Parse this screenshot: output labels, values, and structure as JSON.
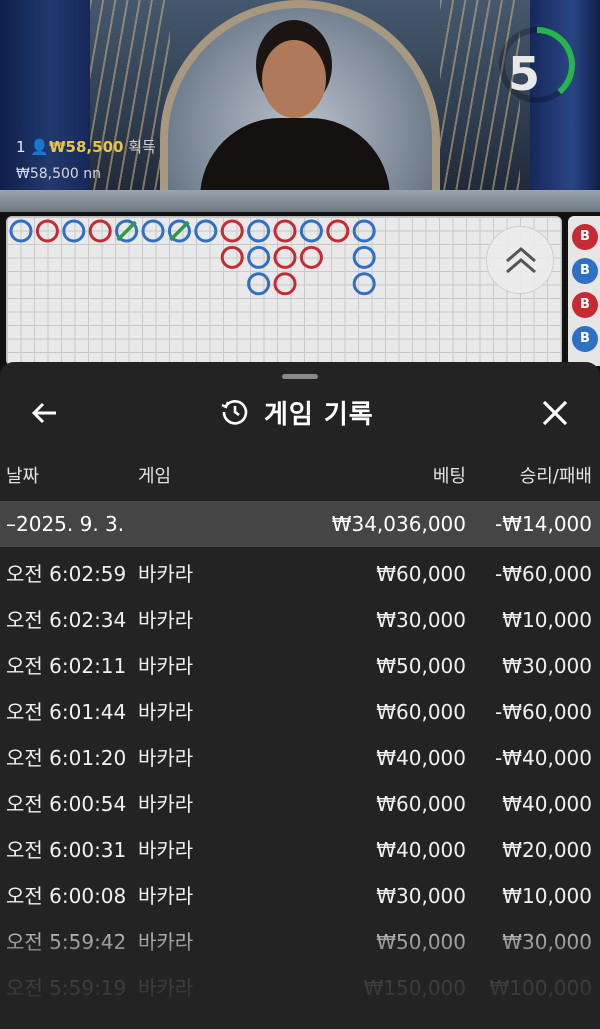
{
  "stream": {
    "countdown": "5",
    "players_count": "1",
    "players_amount": "₩58,500",
    "players_suffix": "획득",
    "players_sub": "₩58,500 nn"
  },
  "bead_road": {
    "columns": [
      [
        "P"
      ],
      [
        "B"
      ],
      [
        "P"
      ],
      [
        "B"
      ],
      [
        "P-tie"
      ],
      [
        "P"
      ],
      [
        "P-tie"
      ],
      [
        "P"
      ],
      [
        "B",
        "B"
      ],
      [
        "P",
        "P",
        "P"
      ],
      [
        "B",
        "B",
        "B"
      ],
      [
        "P",
        "B"
      ],
      [
        "B"
      ],
      [
        "P",
        "P",
        "P"
      ]
    ],
    "side_labels": [
      "B",
      "B",
      "B",
      "B"
    ]
  },
  "history": {
    "title": "게임 기록",
    "headers": {
      "date": "날짜",
      "game": "게임",
      "bet": "베팅",
      "result": "승리/패배"
    },
    "summary": {
      "date": "–2025. 9. 3.",
      "bet": "₩34,036,000",
      "result": "-₩14,000"
    },
    "rows": [
      {
        "time": "오전 6:02:59",
        "game": "바카라",
        "bet": "₩60,000",
        "result": "-₩60,000"
      },
      {
        "time": "오전 6:02:34",
        "game": "바카라",
        "bet": "₩30,000",
        "result": "₩10,000"
      },
      {
        "time": "오전 6:02:11",
        "game": "바카라",
        "bet": "₩50,000",
        "result": "₩30,000"
      },
      {
        "time": "오전 6:01:44",
        "game": "바카라",
        "bet": "₩60,000",
        "result": "-₩60,000"
      },
      {
        "time": "오전 6:01:20",
        "game": "바카라",
        "bet": "₩40,000",
        "result": "-₩40,000"
      },
      {
        "time": "오전 6:00:54",
        "game": "바카라",
        "bet": "₩60,000",
        "result": "₩40,000"
      },
      {
        "time": "오전 6:00:31",
        "game": "바카라",
        "bet": "₩40,000",
        "result": "₩20,000"
      },
      {
        "time": "오전 6:00:08",
        "game": "바카라",
        "bet": "₩30,000",
        "result": "₩10,000"
      },
      {
        "time": "오전 5:59:42",
        "game": "바카라",
        "bet": "₩50,000",
        "result": "₩30,000"
      },
      {
        "time": "오전 5:59:19",
        "game": "바카라",
        "bet": "₩150,000",
        "result": "₩100,000"
      }
    ]
  },
  "colors": {
    "banker": "#c62a33",
    "player": "#2f6fc4",
    "tie": "#2f9a46",
    "timer_ring": "#25b54a",
    "panel_bg": "#232323",
    "summary_bg": "#454545",
    "gold": "#e9c34b"
  },
  "icons": {
    "back": "arrow-left-icon",
    "history": "history-clock-icon",
    "close": "close-icon",
    "expand": "chevron-double-up-icon",
    "player_count": "person-icon"
  }
}
